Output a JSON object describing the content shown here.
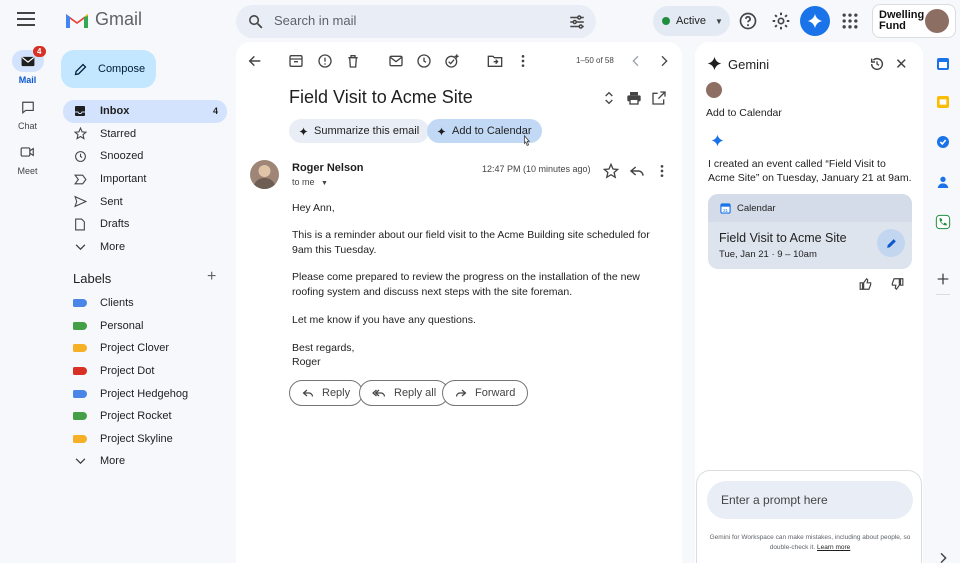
{
  "app": {
    "name": "Gmail"
  },
  "search": {
    "placeholder": "Search in mail"
  },
  "status": {
    "label": "Active",
    "color": "#1e8e3e"
  },
  "brand": {
    "line1": "Dwelling",
    "line2": "Fund"
  },
  "rail": {
    "mail": {
      "label": "Mail",
      "badge": "4"
    },
    "chat": {
      "label": "Chat"
    },
    "meet": {
      "label": "Meet"
    }
  },
  "compose_label": "Compose",
  "folders": [
    {
      "label": "Inbox",
      "count": "4",
      "icon": "inbox-icon"
    },
    {
      "label": "Starred",
      "icon": "star-icon"
    },
    {
      "label": "Snoozed",
      "icon": "clock-icon"
    },
    {
      "label": "Important",
      "icon": "important-icon"
    },
    {
      "label": "Sent",
      "icon": "send-icon"
    },
    {
      "label": "Drafts",
      "icon": "draft-icon"
    },
    {
      "label": "More",
      "icon": "chevron-down-icon"
    }
  ],
  "labels_heading": "Labels",
  "labels": [
    {
      "label": "Clients",
      "color": "#4a86e8"
    },
    {
      "label": "Personal",
      "color": "#43a047"
    },
    {
      "label": "Project Clover",
      "color": "#f6b026"
    },
    {
      "label": "Project Dot",
      "color": "#d93025"
    },
    {
      "label": "Project Hedgehog",
      "color": "#4a86e8"
    },
    {
      "label": "Project Rocket",
      "color": "#43a047"
    },
    {
      "label": "Project Skyline",
      "color": "#f6b026"
    }
  ],
  "labels_more": "More",
  "pager": "1–50 of 58",
  "email": {
    "subject": "Field Visit to Acme Site",
    "summarize_label": "Summarize this email",
    "calendar_label": "Add to Calendar",
    "sender": "Roger Nelson",
    "to": "to me",
    "time": "12:47 PM (10 minutes ago)",
    "greeting": "Hey Ann,",
    "para1": "This is a reminder about our field visit to the Acme Building site scheduled for 9am this Tuesday.",
    "para2": "Please come prepared to review the progress on the installation of the new roofing system and discuss next steps with the site foreman.",
    "para3": "Let me know if you have any questions.",
    "signoff": "Best regards,",
    "signature": "Roger",
    "reply_label": "Reply",
    "reply_all_label": "Reply all",
    "forward_label": "Forward"
  },
  "gemini": {
    "title": "Gemini",
    "user_message": "Add to Calendar",
    "reply": "I created an event called “Field Visit to Acme Site” on Tuesday, January 21 at 9am.",
    "card_header": "Calendar",
    "event_title": "Field Visit to Acme Site",
    "event_time": "Tue, Jan 21 · 9 – 10am",
    "prompt_placeholder": "Enter a prompt here",
    "disclaimer": "Gemini for Workspace can make mistakes, including about people, so double-check it.",
    "learn_more": "Learn more"
  },
  "colors": {
    "accent": "#0b57d0",
    "compose_bg": "#c2e7ff",
    "selected_bg": "#d3e3fd"
  }
}
